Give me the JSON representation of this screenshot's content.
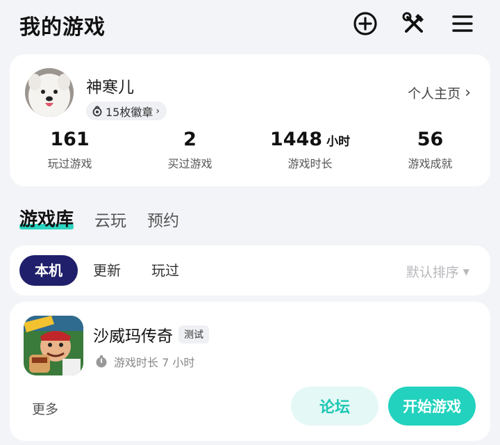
{
  "header": {
    "title": "我的游戏",
    "icons": [
      "add-circle-icon",
      "tools-icon",
      "menu-icon"
    ]
  },
  "profile": {
    "username": "神寒儿",
    "badges": "15枚徽章",
    "home_link": "个人主页",
    "stats": [
      {
        "value": "161",
        "unit": "",
        "label": "玩过游戏"
      },
      {
        "value": "2",
        "unit": "",
        "label": "买过游戏"
      },
      {
        "value": "1448",
        "unit": "小时",
        "label": "游戏时长"
      },
      {
        "value": "56",
        "unit": "",
        "label": "游戏成就"
      }
    ]
  },
  "library_tabs": [
    "游戏库",
    "云玩",
    "预约"
  ],
  "filters": {
    "chips": [
      "本机",
      "更新",
      "玩过"
    ],
    "sort_label": "默认排序"
  },
  "game": {
    "title": "沙威玛传奇",
    "tag": "测试",
    "playtime": "游戏时长 7 小时",
    "more_label": "更多",
    "forum_label": "论坛",
    "start_label": "开始游戏"
  },
  "colors": {
    "accent": "#22d2be",
    "chip_active": "#1f1f6b",
    "background": "#f3f4f7"
  }
}
